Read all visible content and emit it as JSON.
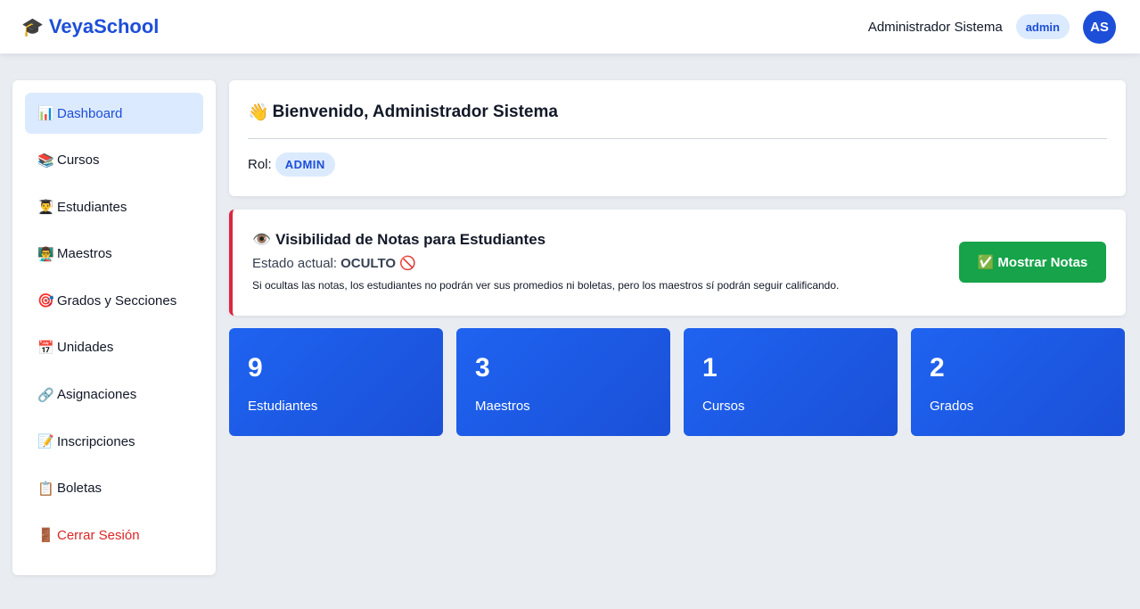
{
  "header": {
    "brand_icon": "🎓",
    "brand_name": "VeyaSchool",
    "user_name": "Administrador Sistema",
    "role_badge": "admin",
    "avatar_initials": "AS"
  },
  "sidebar": {
    "items": [
      {
        "icon": "📊",
        "icon_name": "bar-chart-icon",
        "label": "Dashboard",
        "active": true
      },
      {
        "icon": "📚",
        "icon_name": "books-icon",
        "label": "Cursos"
      },
      {
        "icon": "👨‍🎓",
        "icon_name": "student-icon",
        "label": "Estudiantes"
      },
      {
        "icon": "👨‍🏫",
        "icon_name": "teacher-icon",
        "label": "Maestros"
      },
      {
        "icon": "🎯",
        "icon_name": "target-icon",
        "label": "Grados y Secciones"
      },
      {
        "icon": "📅",
        "icon_name": "calendar-icon",
        "label": "Unidades"
      },
      {
        "icon": "🔗",
        "icon_name": "link-icon",
        "label": "Asignaciones"
      },
      {
        "icon": "📝",
        "icon_name": "memo-icon",
        "label": "Inscripciones"
      },
      {
        "icon": "📋",
        "icon_name": "clipboard-icon",
        "label": "Boletas"
      },
      {
        "icon": "🚪",
        "icon_name": "door-icon",
        "label": "Cerrar Sesión"
      }
    ]
  },
  "welcome": {
    "icon": "👋",
    "title": "Bienvenido, Administrador Sistema",
    "rol_label": "Rol:",
    "rol_value": "ADMIN"
  },
  "visibility": {
    "icon": "👁️",
    "title": "Visibilidad de Notas para Estudiantes",
    "status_label": "Estado actual:",
    "status_value": "OCULTO",
    "status_icon": "🚫",
    "note": "Si ocultas las notas, los estudiantes no podrán ver sus promedios ni boletas, pero los maestros sí podrán seguir calificando.",
    "button_icon": "✅",
    "button_label": "Mostrar Notas"
  },
  "stats": [
    {
      "value": "9",
      "label": "Estudiantes"
    },
    {
      "value": "3",
      "label": "Maestros"
    },
    {
      "value": "1",
      "label": "Cursos"
    },
    {
      "value": "2",
      "label": "Grados"
    }
  ],
  "colors": {
    "primary": "#1d4ed8",
    "accent_bg": "#dbeafe",
    "success": "#16a34a",
    "danger": "#dc2626",
    "page_bg": "#e9edf2"
  }
}
